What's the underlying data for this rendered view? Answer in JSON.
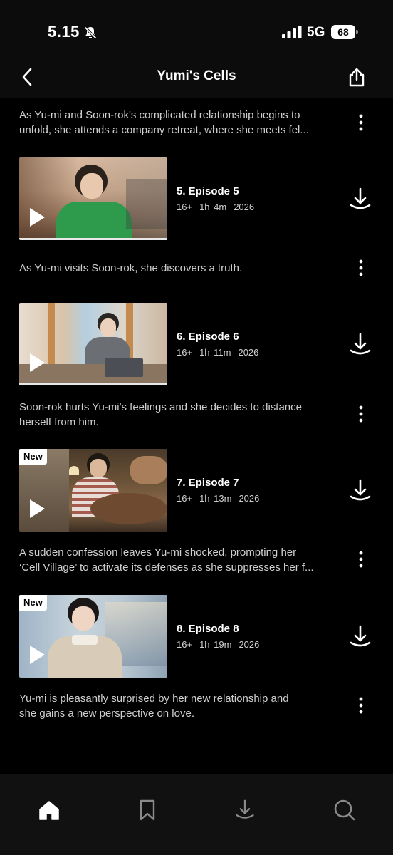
{
  "status": {
    "time": "5.15",
    "network": "5G",
    "battery": "68"
  },
  "header": {
    "title": "Yumi's Cells"
  },
  "intro_description": {
    "line1": "As Yu-mi and Soon-rok's complicated relationship begins to",
    "line2": "unfold, she attends a company retreat, where she meets fel..."
  },
  "episodes": [
    {
      "title": "5. Episode 5",
      "rating": "16+",
      "duration": "1h 4m",
      "year": "2026",
      "badge": "",
      "description": [
        "As Yu-mi visits Soon-rok, she discovers a truth."
      ]
    },
    {
      "title": "6. Episode 6",
      "rating": "16+",
      "duration": "1h 11m",
      "year": "2026",
      "badge": "",
      "description": [
        "Soon-rok hurts Yu-mi's feelings and she decides to distance",
        "herself from him."
      ]
    },
    {
      "title": "7. Episode 7",
      "rating": "16+",
      "duration": "1h 13m",
      "year": "2026",
      "badge": "New",
      "description": [
        "A sudden confession leaves Yu-mi shocked, prompting her",
        "‘Cell Village’ to activate its defenses as she suppresses her f..."
      ]
    },
    {
      "title": "8. Episode 8",
      "rating": "16+",
      "duration": "1h 19m",
      "year": "2026",
      "badge": "New",
      "description": [
        "Yu-mi is pleasantly surprised by her new relationship and",
        "she gains a new perspective on love."
      ]
    }
  ],
  "nav": {
    "items": [
      {
        "icon": "home-icon",
        "active": true
      },
      {
        "icon": "bookmark-icon",
        "active": false
      },
      {
        "icon": "download-icon",
        "active": false
      },
      {
        "icon": "search-icon",
        "active": false
      }
    ]
  },
  "colors": {
    "background": "#000000",
    "header": "#0c0c0c",
    "nav": "#111111",
    "text_secondary": "#cfcfcf"
  }
}
